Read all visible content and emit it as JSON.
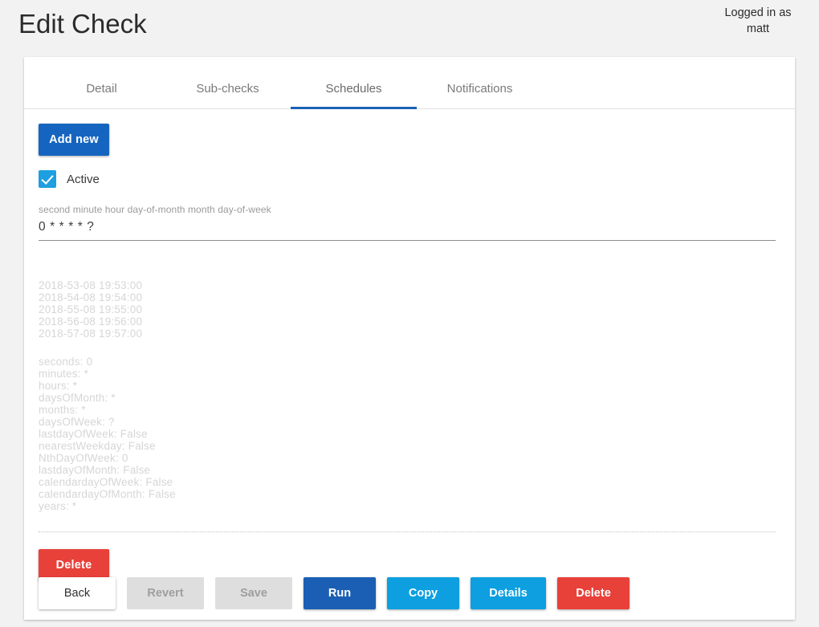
{
  "header": {
    "title": "Edit Check",
    "logged_in_line1": "Logged in as",
    "logged_in_line2": "matt",
    "logged_in_text": "Logged in as matt"
  },
  "tabs": [
    {
      "label": "Detail",
      "active": false
    },
    {
      "label": "Sub-checks",
      "active": false
    },
    {
      "label": "Schedules",
      "active": true
    },
    {
      "label": "Notifications",
      "active": false
    }
  ],
  "schedules": {
    "add_new_label": "Add new",
    "active_checkbox": {
      "label": "Active",
      "checked": true
    },
    "cron_field": {
      "hint": "second minute hour day-of-month month day-of-week",
      "value": "0 * * * * ?"
    },
    "next_runs": [
      "2018-53-08 19:53:00",
      "2018-54-08 19:54:00",
      "2018-55-08 19:55:00",
      "2018-56-08 19:56:00",
      "2018-57-08 19:57:00"
    ],
    "parsed_fields": [
      "seconds: 0",
      "minutes: *",
      "hours: *",
      "daysOfMonth: *",
      "months: *",
      "daysOfWeek: ?",
      "lastdayOfWeek: False",
      "nearestWeekday: False",
      "NthDayOfWeek: 0",
      "lastdayOfMonth: False",
      "calendardayOfWeek: False",
      "calendardayOfMonth: False",
      "years: *"
    ],
    "delete_schedule_label": "Delete"
  },
  "footer": {
    "back_label": "Back",
    "revert_label": "Revert",
    "save_label": "Save",
    "run_label": "Run",
    "copy_label": "Copy",
    "details_label": "Details",
    "delete_label": "Delete"
  },
  "colors": {
    "page_background": "#f2f2f2",
    "card_background": "#ffffff",
    "primary_blue": "#1565c0",
    "tab_active_underline": "#1a62b5",
    "run_blue": "#1a5fb4",
    "light_blue": "#0d9fe0",
    "checkbox_blue": "#1e9fe0",
    "danger_red": "#e8413a",
    "disabled_grey": "#dedede",
    "muted_text": "#d6d6d6"
  }
}
